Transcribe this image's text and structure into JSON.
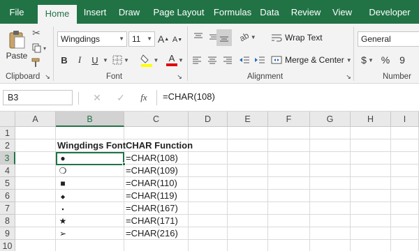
{
  "tabs": [
    "File",
    "Home",
    "Insert",
    "Draw",
    "Page Layout",
    "Formulas",
    "Data",
    "Review",
    "View",
    "Developer"
  ],
  "active_tab": "Home",
  "ribbon": {
    "clipboard": {
      "paste_label": "Paste",
      "group_label": "Clipboard"
    },
    "font": {
      "font_name": "Wingdings",
      "font_size": "11",
      "group_label": "Font",
      "bold": "B",
      "italic": "I",
      "underline": "U",
      "grow": "A",
      "shrink": "A"
    },
    "alignment": {
      "wrap_text": "Wrap Text",
      "merge_center": "Merge & Center",
      "group_label": "Alignment"
    },
    "number": {
      "format": "General",
      "currency": "$",
      "percent": "%",
      "comma": "9",
      "group_label": "Number"
    }
  },
  "formula_bar": {
    "name_box": "B3",
    "fx_label": "fx",
    "formula": "=CHAR(108)"
  },
  "columns": [
    "A",
    "B",
    "C",
    "D",
    "E",
    "F",
    "G",
    "H",
    "I"
  ],
  "rows": [
    "1",
    "2",
    "3",
    "4",
    "5",
    "6",
    "7",
    "8",
    "9",
    "10"
  ],
  "headers": {
    "b": "Wingdings Font",
    "c": "CHAR Function"
  },
  "data_rows": [
    {
      "symbol": "●",
      "formula": "=CHAR(108)"
    },
    {
      "symbol": "❍",
      "formula": "=CHAR(109)"
    },
    {
      "symbol": "■",
      "formula": "=CHAR(110)"
    },
    {
      "symbol": "⬥",
      "formula": "=CHAR(119)"
    },
    {
      "symbol": "▪",
      "formula": "=CHAR(167)"
    },
    {
      "symbol": "★",
      "formula": "=CHAR(171)"
    },
    {
      "symbol": "➢",
      "formula": "=CHAR(216)"
    }
  ],
  "colors": {
    "accent": "#217346",
    "ribbon_bg": "#f3f3f3"
  }
}
